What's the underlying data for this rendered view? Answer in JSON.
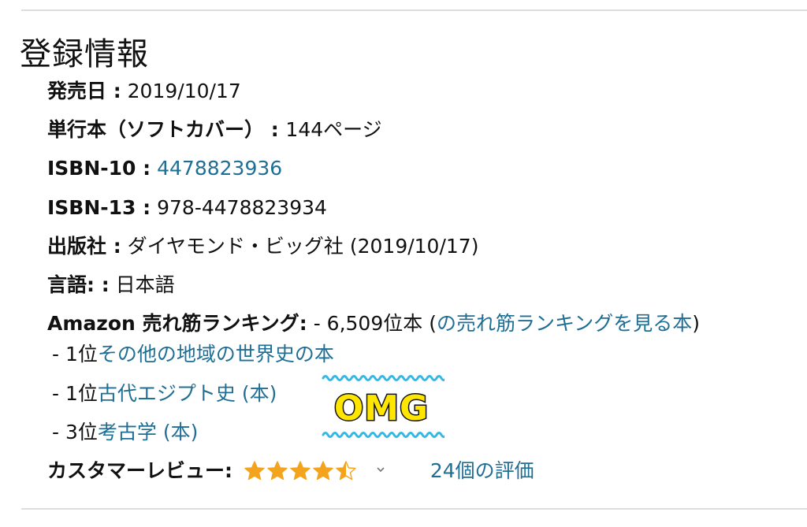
{
  "section_title": "登録情報",
  "details": {
    "release_date": {
      "label": "発売日 :",
      "value": "2019/10/17"
    },
    "format": {
      "label": "単行本（ソフトカバー）",
      "sep": " : ",
      "value": "144ページ"
    },
    "isbn10": {
      "label": "ISBN-10 :",
      "value": "4478823936"
    },
    "isbn13": {
      "label": "ISBN-13 :",
      "value": "978-4478823934"
    },
    "publisher": {
      "label": "出版社 :",
      "value": "ダイヤモンド・ビッグ社 (2019/10/17)"
    },
    "language": {
      "label": "言語: :",
      "value": "日本語"
    }
  },
  "ranking": {
    "label": "Amazon 売れ筋ランキング:",
    "value": "- 6,509位本",
    "paren_open": "(",
    "link": "の売れ筋ランキングを見る本",
    "paren_close": ")",
    "sub_items": [
      {
        "rank": "- 1位",
        "category": "その他の地域の世界史の本"
      },
      {
        "rank": "- 1位",
        "category": "古代エジプト史 (本)"
      },
      {
        "rank": "- 3位",
        "category": "考古学 (本)"
      }
    ]
  },
  "reviews": {
    "label": "カスタマーレビュー:",
    "rating": 4.5,
    "count_text": "24個の評価",
    "star_color": "#f4a41c",
    "star_icon": "star-icon",
    "dropdown_icon": "chevron-down-icon"
  },
  "sticker": {
    "text": "OMG",
    "fill_color": "#ffe600",
    "wave_color": "#35b8e6"
  }
}
